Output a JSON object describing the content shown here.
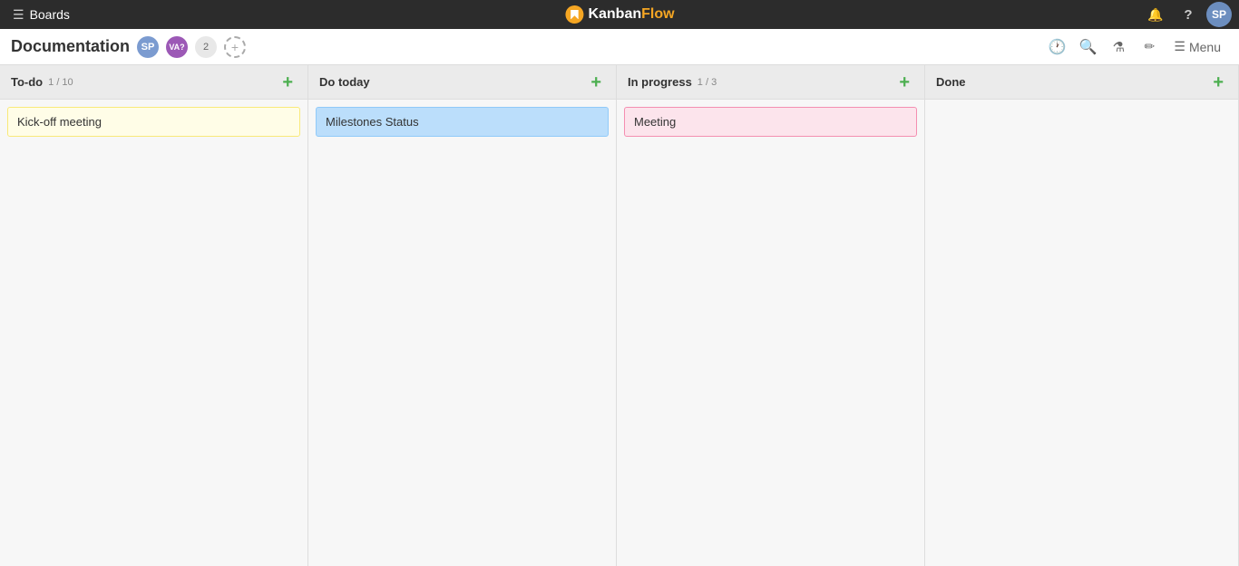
{
  "topbar": {
    "boards_label": "Boards",
    "logo_kanban": "Kanban",
    "logo_flow": "Flow",
    "avatar_initials": "SP",
    "notification_icon": "🔔",
    "help_icon": "?",
    "hamburger": "☰"
  },
  "subheader": {
    "title": "Documentation",
    "member1_initials": "SP",
    "member2_initials": "VA?",
    "member_count": "2",
    "add_member_icon": "+",
    "menu_label": "Menu",
    "icons": {
      "history": "🕐",
      "search": "🔍",
      "filter": "⚗",
      "edit": "✏"
    }
  },
  "columns": [
    {
      "id": "todo",
      "title": "To-do",
      "count": "1 / 10",
      "cards": [
        {
          "id": "c1",
          "text": "Kick-off meeting",
          "color": "yellow"
        }
      ]
    },
    {
      "id": "dotoday",
      "title": "Do today",
      "count": "",
      "cards": [
        {
          "id": "c2",
          "text": "Milestones Status",
          "color": "blue"
        }
      ]
    },
    {
      "id": "inprogress",
      "title": "In progress",
      "count": "1 / 3",
      "cards": [
        {
          "id": "c3",
          "text": "Meeting",
          "color": "pink"
        }
      ]
    },
    {
      "id": "done",
      "title": "Done",
      "count": "",
      "cards": []
    }
  ]
}
